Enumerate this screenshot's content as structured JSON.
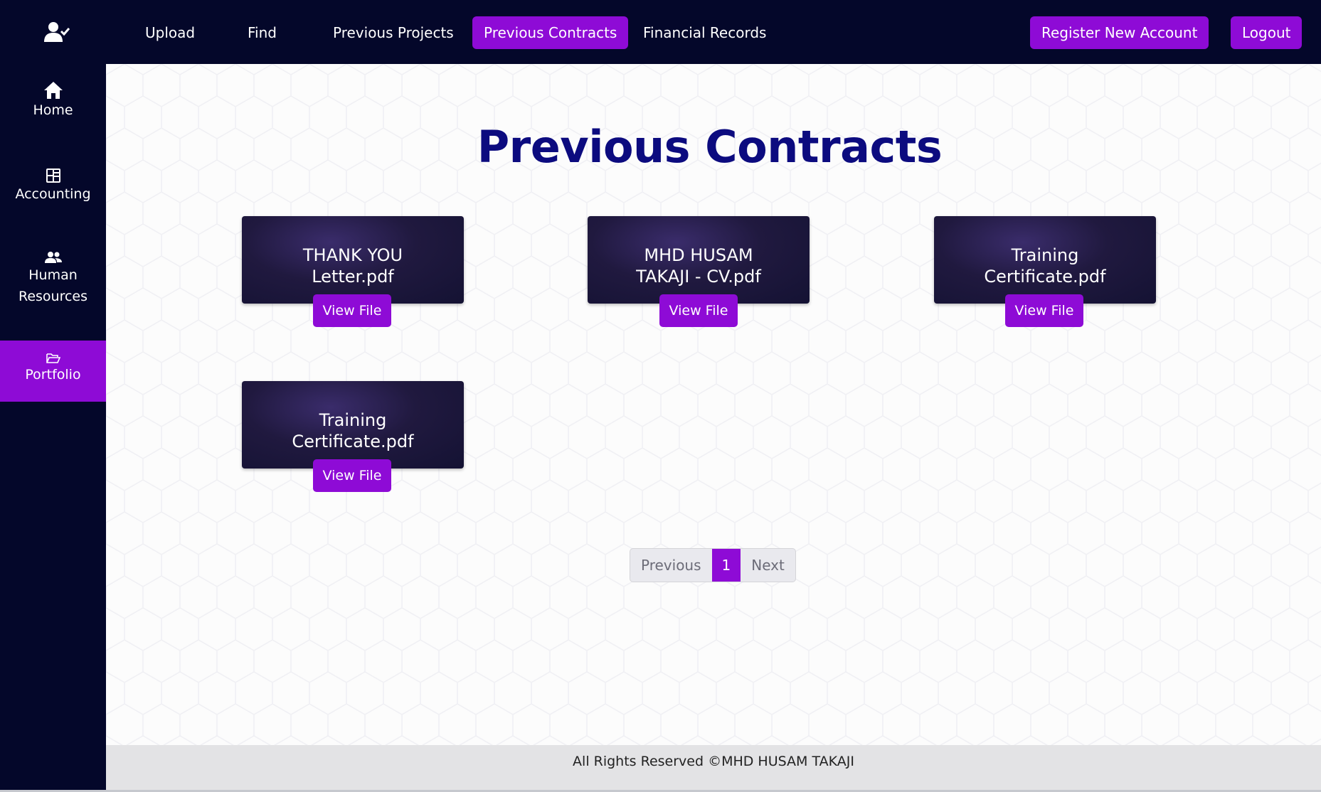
{
  "topnav": {
    "items": [
      {
        "label": "Upload"
      },
      {
        "label": "Find"
      },
      {
        "label": "Previous Projects"
      },
      {
        "label": "Previous Contracts",
        "active": true
      },
      {
        "label": "Financial Records"
      }
    ],
    "register_label": "Register New Account",
    "logout_label": "Logout"
  },
  "sidebar": {
    "items": [
      {
        "label": "Home",
        "icon": "home-icon"
      },
      {
        "label": "Accounting",
        "icon": "accounting-icon"
      },
      {
        "label_line1": "Human",
        "label_line2": "Resources",
        "icon": "users-icon"
      },
      {
        "label": "Portfolio",
        "icon": "folder-open-icon",
        "active": true
      }
    ]
  },
  "main": {
    "title": "Previous Contracts",
    "files": [
      {
        "line1": "THANK YOU",
        "line2": "Letter.pdf",
        "button": "View File"
      },
      {
        "line1": "MHD HUSAM",
        "line2": "TAKAJI - CV.pdf",
        "button": "View File"
      },
      {
        "line1": "Training",
        "line2": "Certificate.pdf",
        "button": "View File"
      },
      {
        "line1": "Training",
        "line2": "Certificate.pdf",
        "button": "View File"
      }
    ],
    "pagination": {
      "previous": "Previous",
      "current": "1",
      "next": "Next"
    }
  },
  "footer": {
    "text": "All Rights Reserved ©MHD HUSAM TAKAJI"
  },
  "colors": {
    "accent": "#8e0bd6",
    "nav_bg": "#04072a",
    "title": "#0c0b7f"
  }
}
